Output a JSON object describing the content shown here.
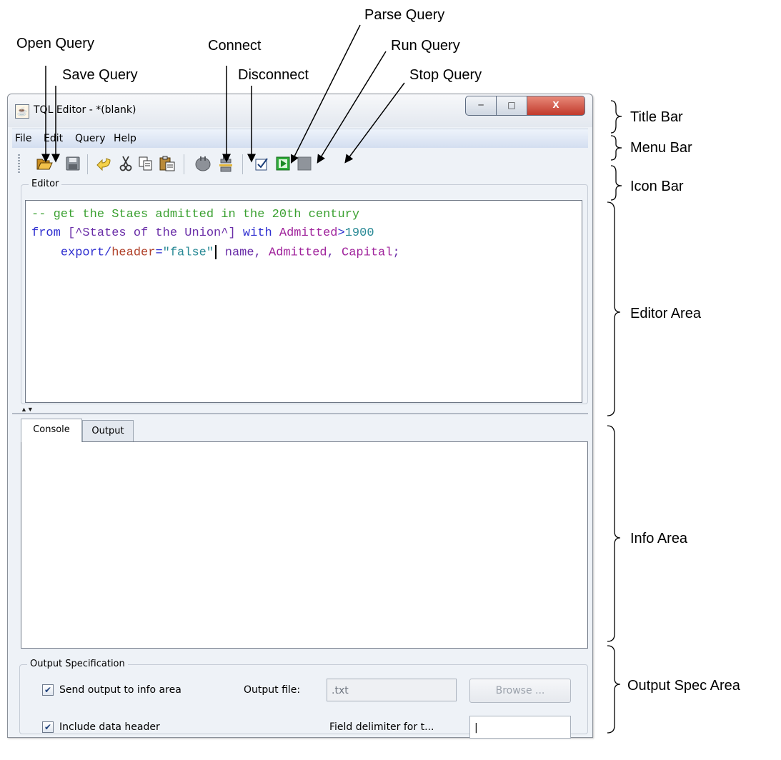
{
  "callouts": {
    "open_query": "Open Query",
    "save_query": "Save Query",
    "connect": "Connect",
    "disconnect": "Disconnect",
    "parse_query": "Parse Query",
    "run_query": "Run Query",
    "stop_query": "Stop Query"
  },
  "regions": {
    "title_bar": "Title Bar",
    "menu_bar": "Menu Bar",
    "icon_bar": "Icon Bar",
    "editor_area": "Editor Area",
    "info_area": "Info Area",
    "output_spec_area": "Output Spec Area"
  },
  "window": {
    "title": "TQL Editor -  *(blank)"
  },
  "menu": [
    "File",
    "Edit",
    "Query",
    "Help"
  ],
  "toolbar_icons": [
    "open-folder-icon",
    "save-disk-icon",
    "undo-icon",
    "cut-scissors-icon",
    "copy-icon",
    "paste-icon",
    "connect-plug-icon",
    "disconnect-plug-icon",
    "parse-check-icon",
    "run-play-icon",
    "stop-square-icon"
  ],
  "editor": {
    "label": "Editor",
    "line1": "-- get the Staes admitted in the 20th century",
    "line2": {
      "kw_from": "from",
      "bracket_open": " [",
      "table": "^States of the Union^",
      "bracket_close": "] ",
      "kw_with": "with",
      "space": " ",
      "field": "Admitted",
      "op": ">",
      "num": "1900"
    },
    "line3": {
      "indent": "    ",
      "kw_export": "export",
      "slash": "/",
      "kw_header": "header",
      "eq": "=",
      "str": "\"false\"",
      "name": " name, ",
      "f1": "Admitted",
      "comma": ", ",
      "f2": "Capital",
      "semi": ";"
    }
  },
  "info": {
    "tabs": [
      "Console",
      "Output"
    ]
  },
  "output_spec": {
    "label": "Output Specification",
    "send_output_label": "Send output to info area",
    "send_output_checked": true,
    "include_header_label": "Include data header",
    "include_header_checked": true,
    "output_file_label": "Output file:",
    "output_file_value": ".txt",
    "browse_label": "Browse ...",
    "delimiter_label": "Field delimiter for t...",
    "delimiter_value": "|"
  },
  "colors": {
    "comment": "#3aa030",
    "keyword": "#2f2fd0",
    "bracket": "#6a2ea8",
    "field": "#a0249c",
    "number": "#2a8a96",
    "header_kw": "#b0412a",
    "string": "#2a8a96"
  }
}
